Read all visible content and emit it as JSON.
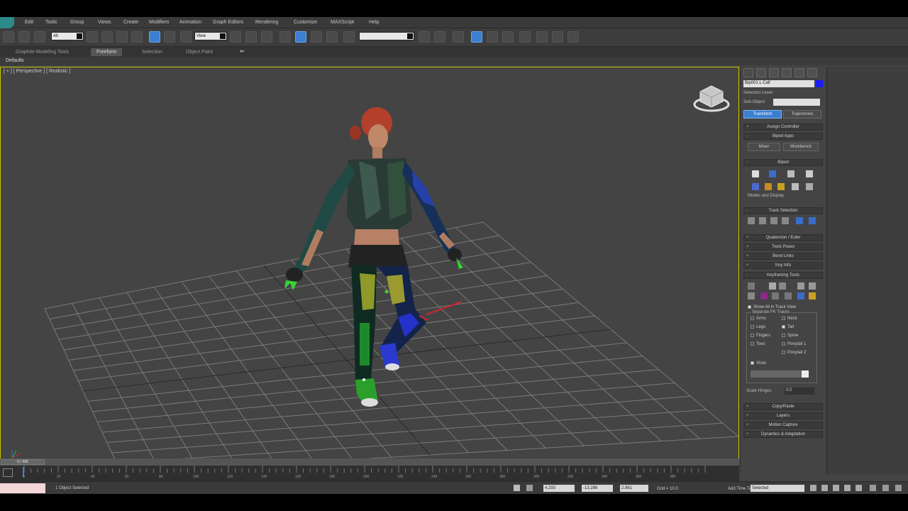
{
  "menu": [
    "Edit",
    "Tools",
    "Group",
    "Views",
    "Create",
    "Modifiers",
    "Animation",
    "Graph Editors",
    "Rendering",
    "Customize",
    "MAXScript",
    "Help"
  ],
  "toolbar": {
    "layer_dropdown": "All",
    "view_dropdown": "View",
    "named_selection": ""
  },
  "ribbon": {
    "tabs": [
      "Graphite Modeling Tools",
      "Freeform",
      "Selection",
      "Object Paint"
    ],
    "active_tab": "Freeform",
    "sub_label": "Defaults"
  },
  "viewport": {
    "label": "[ + ] [ Perspective ] [ Realistic ]",
    "accent": "#c8c800"
  },
  "command_panel": {
    "object_name": "Bip001 L Calf",
    "object_color": "#1c1cff",
    "selection_level_label": "Selection Level:",
    "sub_anim_label": "Sub-Object",
    "tabs": [
      "Transform",
      "Trajectories"
    ],
    "assign_controller": "Assign Controller",
    "biped_apps": "Biped Apps",
    "mixer_btn": "Mixer",
    "workbench_btn": "Workbench",
    "biped": "Biped",
    "modes_display": "Modes and Display",
    "track_selection": "Track Selection",
    "quaternion_euler": "Quaternion / Euler",
    "twist_poses": "Twist Poses",
    "bend_links": "Bend Links",
    "key_info": "Key Info",
    "keyframing_tools": "Keyframing Tools",
    "show_all": "Show All in Track View",
    "separate_tracks": "Separate FK Tracks",
    "tracks": [
      {
        "label": "Arms",
        "on": false
      },
      {
        "label": "Neck",
        "on": false
      },
      {
        "label": "Legs",
        "on": false
      },
      {
        "label": "Tail",
        "on": true
      },
      {
        "label": "Fingers",
        "on": false
      },
      {
        "label": "Spine",
        "on": false
      },
      {
        "label": "Toes",
        "on": false
      },
      {
        "label": "Ponytail 1",
        "on": false
      },
      {
        "label": "Ponytail 2",
        "on": false
      }
    ],
    "xtras": "Xtras",
    "scale_label": "Scale Hinges",
    "scale_value": "0.0",
    "copy_paste": "Copy/Paste",
    "layers": "Layers",
    "motion_capture": "Motion Capture",
    "dynamics": "Dynamics & Adaptation"
  },
  "timeline": {
    "slider_label": "0 / 400",
    "ticks": [
      "0",
      "20",
      "40",
      "60",
      "80",
      "100",
      "120",
      "140",
      "160",
      "180",
      "200",
      "220",
      "240",
      "260",
      "280",
      "300",
      "320",
      "340",
      "360",
      "380"
    ]
  },
  "status": {
    "text": "1 Object Selected",
    "x": "4.293",
    "y": "-13.286",
    "z": "2.861",
    "grid": "Grid = 10.0",
    "add_time_tag": "Add Time Tag",
    "key_filter": "Selected",
    "accent_time": "#3c7fd0"
  }
}
